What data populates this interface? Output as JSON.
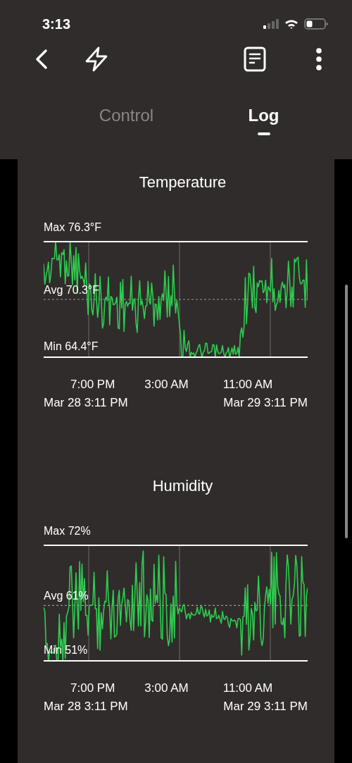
{
  "status_bar": {
    "time": "3:13"
  },
  "tabs": [
    {
      "label": "Control",
      "selected": false
    },
    {
      "label": "Log",
      "selected": true
    }
  ],
  "charts": [
    {
      "title": "Temperature",
      "max_label": "Max 76.3°F",
      "avg_label": "Avg 70.3°F",
      "min_label": "Min 64.4°F",
      "time_labels": [
        "7:00 PM",
        "3:00 AM",
        "11:00 AM"
      ],
      "start": "Mar 28 3:11 PM",
      "end": "Mar 29 3:11 PM"
    },
    {
      "title": "Humidity",
      "max_label": "Max 72%",
      "avg_label": "Avg 61%",
      "min_label": "Min 51%",
      "time_labels": [
        "7:00 PM",
        "3:00 AM",
        "11:00 AM"
      ],
      "start": "Mar 28 3:11 PM",
      "end": "Mar 29 3:11 PM"
    }
  ]
}
